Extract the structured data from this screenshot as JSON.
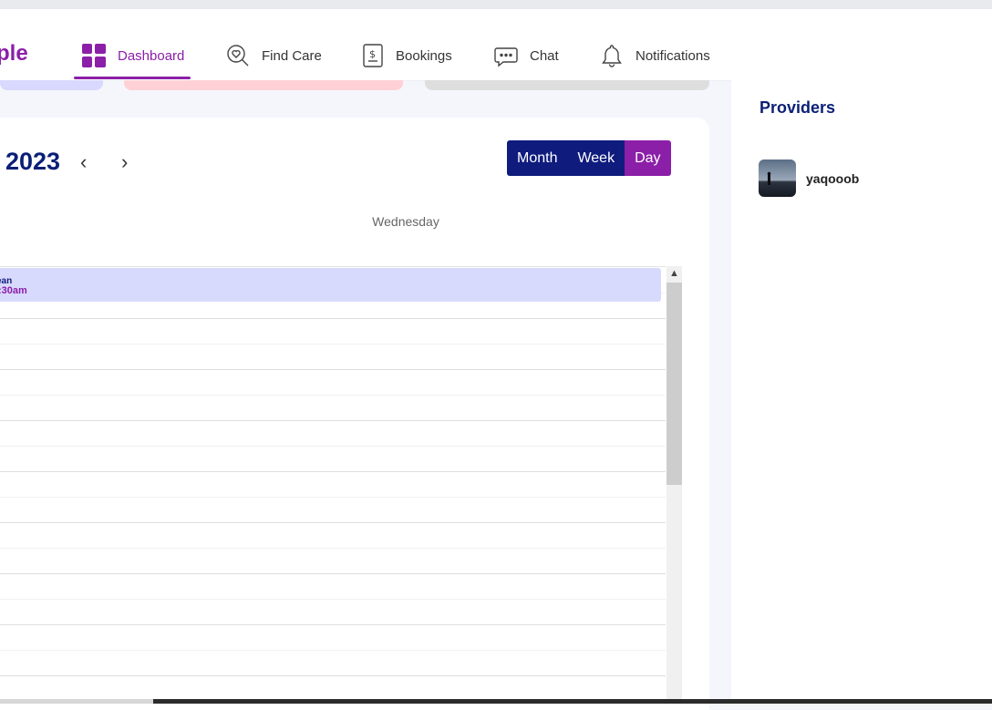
{
  "app": {
    "logo_text": "ple"
  },
  "nav": {
    "items": [
      {
        "label": "Dashboard",
        "icon": "dashboard-grid-icon",
        "active": true
      },
      {
        "label": "Find Care",
        "icon": "find-care-search-heart-icon",
        "active": false
      },
      {
        "label": "Bookings",
        "icon": "bookings-document-dollar-icon",
        "active": false
      },
      {
        "label": "Chat",
        "icon": "chat-bubble-icon",
        "active": false
      },
      {
        "label": "Notifications",
        "icon": "bell-icon",
        "active": false
      }
    ]
  },
  "calendar": {
    "title": "2023",
    "prev_icon": "chevron-left-icon",
    "next_icon": "chevron-right-icon",
    "views": [
      {
        "label": "Month",
        "active": false
      },
      {
        "label": "Week",
        "active": false
      },
      {
        "label": "Day",
        "active": true
      }
    ],
    "day_header": "Wednesday",
    "event": {
      "title": "ean",
      "time": ":30am"
    }
  },
  "providers": {
    "title": "Providers",
    "items": [
      {
        "name": "yaqooob",
        "avatar": "person-silhouette-avatar"
      }
    ]
  },
  "colors": {
    "brand_purple": "#8b1fa8",
    "navy": "#0f1c7d",
    "event_bg": "#d8dafd"
  }
}
